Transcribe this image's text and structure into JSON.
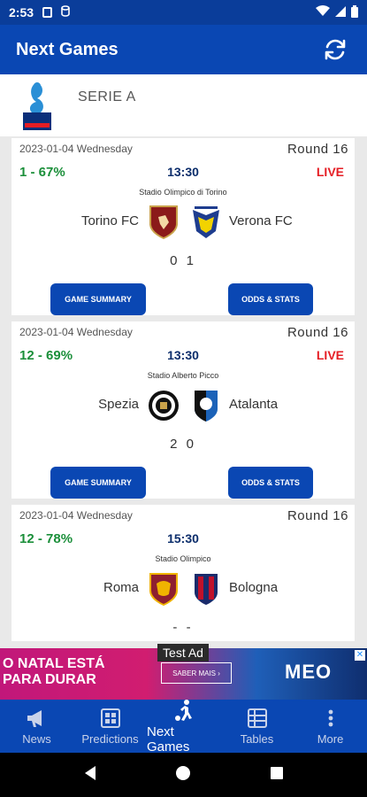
{
  "status": {
    "time": "2:53"
  },
  "appbar": {
    "title": "Next Games"
  },
  "league": {
    "name": "SERIE A"
  },
  "games": [
    {
      "date": "2023-01-04 Wednesday",
      "round": "Round  16",
      "odds": "1 - 67%",
      "time": "13:30",
      "live": "LIVE",
      "stadium": "Stadio Olimpico di Torino",
      "home": "Torino FC",
      "away": "Verona FC",
      "score": "0 1",
      "summary_label": "GAME SUMMARY",
      "stats_label": "ODDS & STATS"
    },
    {
      "date": "2023-01-04 Wednesday",
      "round": "Round  16",
      "odds": "12 - 69%",
      "time": "13:30",
      "live": "LIVE",
      "stadium": "Stadio Alberto Picco",
      "home": "Spezia",
      "away": "Atalanta",
      "score": "2 0",
      "summary_label": "GAME SUMMARY",
      "stats_label": "ODDS & STATS"
    },
    {
      "date": "2023-01-04 Wednesday",
      "round": "Round  16",
      "odds": "12 - 78%",
      "time": "15:30",
      "live": "",
      "stadium": "Stadio Olimpico",
      "home": "Roma",
      "away": "Bologna",
      "score": "- -"
    }
  ],
  "ad": {
    "label": "Test Ad",
    "text_line1": "O NATAL ESTÁ",
    "text_line2": "PARA DURAR",
    "cta": "SABER MAIS ›",
    "brand": "MEO"
  },
  "nav": [
    {
      "label": "News",
      "icon": "megaphone-icon"
    },
    {
      "label": "Predictions",
      "icon": "grid-icon"
    },
    {
      "label": "Next Games",
      "icon": "soccer-player-icon",
      "active": true
    },
    {
      "label": "Tables",
      "icon": "table-icon"
    },
    {
      "label": "More",
      "icon": "more-vertical-icon"
    }
  ],
  "colors": {
    "primary": "#0a47b3",
    "odds_green": "#1b8f3a",
    "live_red": "#e51d24"
  }
}
